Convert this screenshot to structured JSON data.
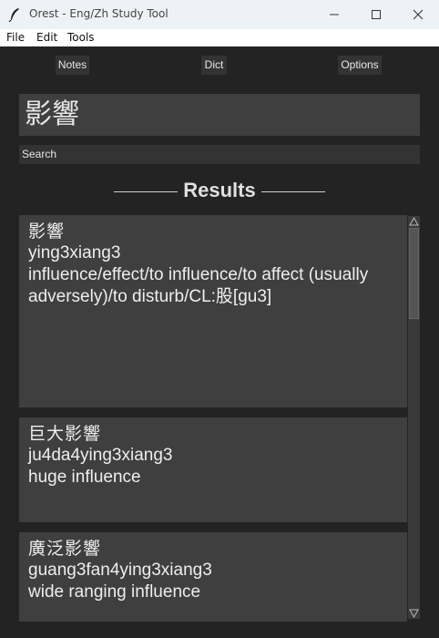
{
  "window": {
    "title": "Orest - Eng/Zh Study Tool"
  },
  "menubar": {
    "items": [
      "File",
      "Edit",
      "Tools"
    ]
  },
  "nav": {
    "notes": "Notes",
    "dict": "Dict",
    "options": "Options"
  },
  "current_word": "影響",
  "search": {
    "value": "Search"
  },
  "results_header": "Results",
  "results": [
    {
      "hanzi": "影響",
      "pinyin": "ying3xiang3",
      "definition": "influence/effect/to influence/to affect (usually adversely)/to disturb/CL:股[gu3]"
    },
    {
      "hanzi": "巨大影響",
      "pinyin": "ju4da4ying3xiang3",
      "definition": "huge influence"
    },
    {
      "hanzi": "廣泛影響",
      "pinyin": "guang3fan4ying3xiang3",
      "definition": "wide ranging influence"
    }
  ],
  "colors": {
    "background": "#232323",
    "panel": "#3f3f3f",
    "text": "#eeeeee"
  },
  "icons": {
    "app": "feather-icon",
    "minimize": "minimize-icon",
    "maximize": "maximize-icon",
    "close": "close-icon"
  }
}
